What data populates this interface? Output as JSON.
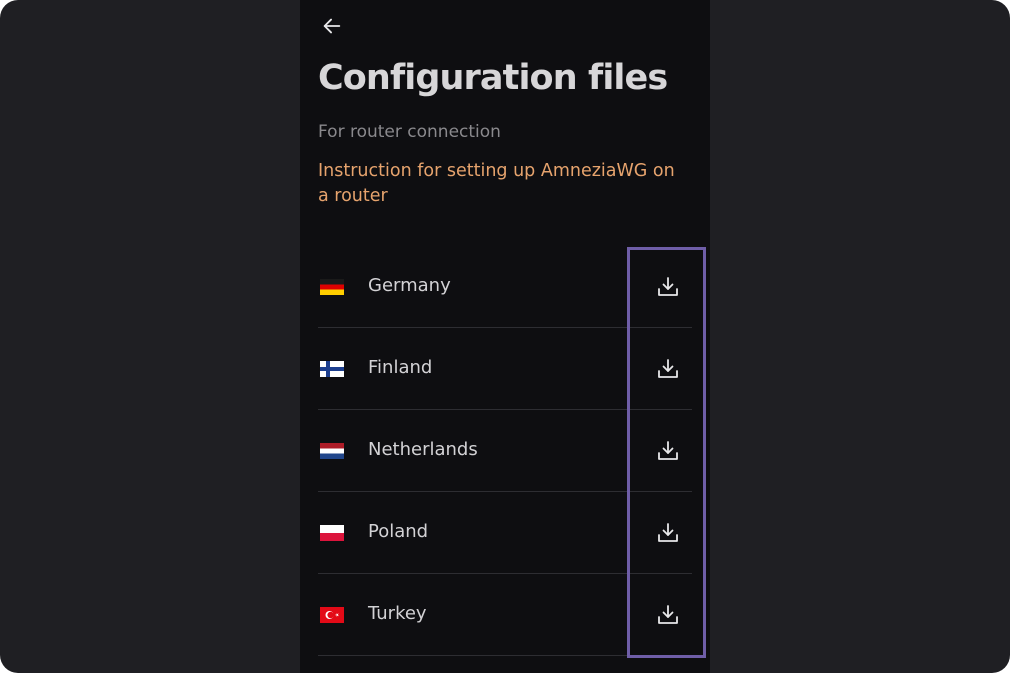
{
  "page": {
    "title": "Configuration files",
    "subtitle": "For router connection",
    "instruction_link": "Instruction for setting up AmneziaWG on a router"
  },
  "icons": {
    "back": "arrow-left-icon",
    "download": "download-icon"
  },
  "countries": [
    {
      "name": "Germany",
      "flag": "germany-flag"
    },
    {
      "name": "Finland",
      "flag": "finland-flag"
    },
    {
      "name": "Netherlands",
      "flag": "netherlands-flag"
    },
    {
      "name": "Poland",
      "flag": "poland-flag"
    },
    {
      "name": "Turkey",
      "flag": "turkey-flag"
    }
  ],
  "colors": {
    "background": "#1f1f23",
    "screen": "#0e0e11",
    "title": "#d7d6d8",
    "accent_link": "#e6a36d",
    "highlight": "#6f5ea8"
  }
}
